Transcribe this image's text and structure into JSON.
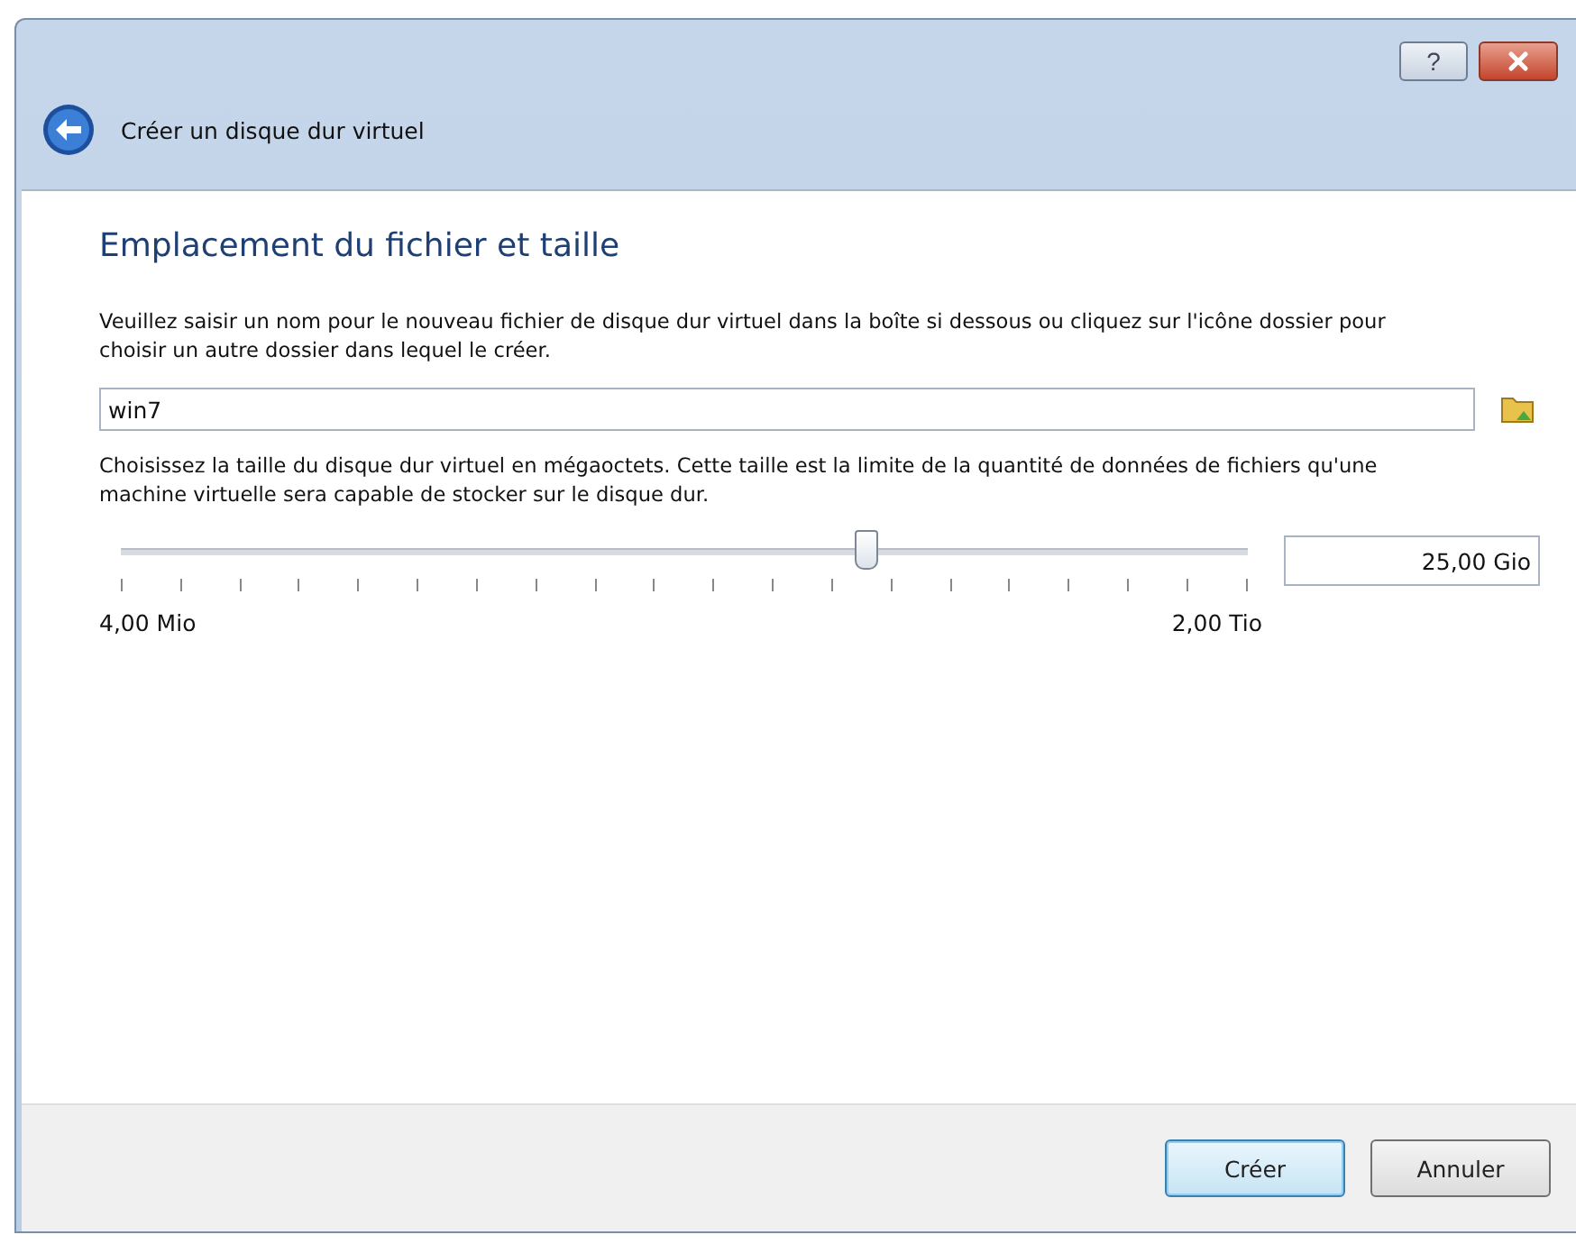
{
  "window": {
    "title": "Créer un disque dur virtuel",
    "help_button": "?"
  },
  "heading": "Emplacement du fichier et taille",
  "file_instructions": "Veuillez saisir un nom pour le nouveau fichier de disque dur virtuel dans la boîte si dessous ou cliquez sur l'icône dossier pour choisir un autre dossier dans lequel le créer.",
  "file_name": {
    "value": "win7"
  },
  "size_instructions": "Choisissez la taille du disque dur virtuel en mégaoctets. Cette taille est la limite de la quantité de données de fichiers qu'une machine virtuelle sera capable de stocker sur le disque dur.",
  "size_slider": {
    "level": 0.66,
    "min_label": "4,00 Mio",
    "max_label": "2,00 Tio"
  },
  "size_field": {
    "value": "25,00 Gio"
  },
  "buttons": [
    {
      "label": "Créer",
      "default": true
    },
    {
      "label": "Annuler",
      "default": false
    }
  ]
}
